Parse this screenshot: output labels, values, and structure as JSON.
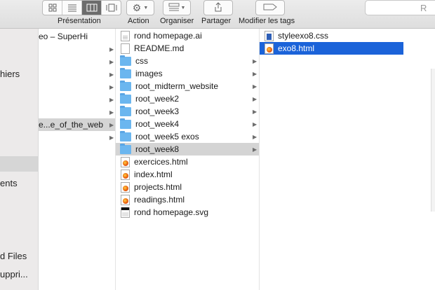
{
  "toolbar": {
    "presentation_label": "Présentation",
    "action_label": "Action",
    "organiser_label": "Organiser",
    "partager_label": "Partager",
    "tags_label": "Modifier les tags",
    "search_partial": "R"
  },
  "sidebar": {
    "items": [
      "hiers",
      "ents",
      "d Files",
      "uppri..."
    ]
  },
  "column1": {
    "items": [
      {
        "label": "eo – SuperHi",
        "arrow": false
      },
      {
        "label": "",
        "arrow": true
      },
      {
        "label": "",
        "arrow": true
      },
      {
        "label": "",
        "arrow": true
      },
      {
        "label": "",
        "arrow": true
      },
      {
        "label": "",
        "arrow": true
      },
      {
        "label": "",
        "arrow": true
      },
      {
        "label": "e...e_of_the_web",
        "arrow": true,
        "state": "path"
      },
      {
        "label": "",
        "arrow": true
      }
    ]
  },
  "column2": {
    "items": [
      {
        "label": "rond homepage.ai",
        "icon": "ai",
        "arrow": false
      },
      {
        "label": "README.md",
        "icon": "doc",
        "arrow": false
      },
      {
        "label": "css",
        "icon": "folder",
        "arrow": true
      },
      {
        "label": "images",
        "icon": "folder",
        "arrow": true
      },
      {
        "label": "root_midterm_website",
        "icon": "folder",
        "arrow": true
      },
      {
        "label": "root_week2",
        "icon": "folder",
        "arrow": true
      },
      {
        "label": "root_week3",
        "icon": "folder",
        "arrow": true
      },
      {
        "label": "root_week4",
        "icon": "folder",
        "arrow": true
      },
      {
        "label": "root_week5 exos",
        "icon": "folder",
        "arrow": true
      },
      {
        "label": "root_week8",
        "icon": "folder",
        "arrow": true,
        "state": "path"
      },
      {
        "label": "exercices.html",
        "icon": "html",
        "arrow": false
      },
      {
        "label": "index.html",
        "icon": "html",
        "arrow": false
      },
      {
        "label": "projects.html",
        "icon": "html",
        "arrow": false
      },
      {
        "label": "readings.html",
        "icon": "html",
        "arrow": false
      },
      {
        "label": "rond homepage.svg",
        "icon": "svg",
        "arrow": false
      }
    ]
  },
  "column3": {
    "items": [
      {
        "label": "styleexo8.css",
        "icon": "css"
      },
      {
        "label": "exo8.html",
        "icon": "html",
        "state": "selected"
      }
    ]
  },
  "colors": {
    "selection": "#1b63d9",
    "path_highlight": "#d4d4d4",
    "folder": "#6bb6ef"
  }
}
